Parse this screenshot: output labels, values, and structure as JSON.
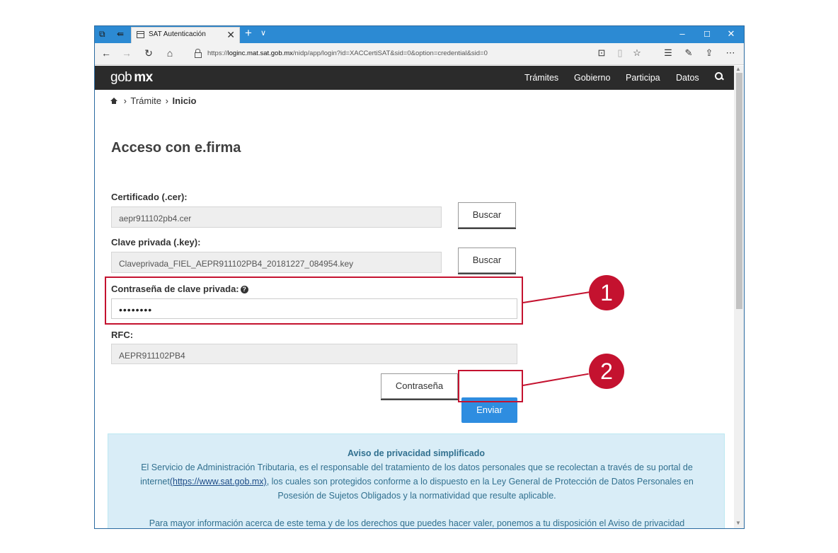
{
  "browser": {
    "tab_title": "SAT Autenticación",
    "url_prefix": "https://",
    "url_host": "loginc.mat.sat.gob.mx",
    "url_path": "/nidp/app/login?id=XACCertiSAT&sid=0&option=credential&sid=0",
    "new_tab_glyph": "+",
    "tab_list_glyph": "∨",
    "close_tab_glyph": "✕",
    "minimize_glyph": "–",
    "maximize_glyph": "☐",
    "close_glyph": "✕"
  },
  "site": {
    "logo_part1": "gob",
    "logo_part2": "mx",
    "nav": [
      "Trámites",
      "Gobierno",
      "Participa",
      "Datos"
    ]
  },
  "breadcrumb": {
    "tramite": "Trámite",
    "current": "Inicio",
    "separator": "›"
  },
  "form": {
    "title": "Acceso con e.firma",
    "cert_label": "Certificado (.cer):",
    "cert_value": "aepr911102pb4.cer",
    "key_label": "Clave privada (.key):",
    "key_value": "Claveprivada_FIEL_AEPR911102PB4_20181227_084954.key",
    "browse_label": "Buscar",
    "password_label": "Contraseña de clave privada:",
    "password_value": "••••••••",
    "help_glyph": "?",
    "rfc_label": "RFC:",
    "rfc_value": "AEPR911102PB4",
    "password_button": "Contraseña",
    "submit_button": "Enviar"
  },
  "privacy": {
    "title": "Aviso de privacidad simplificado",
    "text_before_link": "El Servicio de Administración Tributaria, es el responsable del tratamiento de los datos personales que se recolectan a través de su portal de internet",
    "link": "(https://www.sat.gob.mx)",
    "text_after_link": ", los cuales son protegidos conforme a lo dispuesto en la Ley General de Protección de Datos Personales en Posesión de Sujetos Obligados y la normatividad que resulte aplicable.",
    "more_text": "Para mayor información acerca de este tema y de los derechos que puedes hacer valer, ponemos a tu disposición el Aviso de privacidad"
  },
  "annotations": {
    "step1": "1",
    "step2": "2",
    "color": "#c4122f"
  },
  "colors": {
    "titlebar": "#2c8ad3",
    "header": "#2b2b2b",
    "submit": "#2e8de0",
    "privacy_bg": "#d9edf7",
    "privacy_text": "#31708f"
  }
}
